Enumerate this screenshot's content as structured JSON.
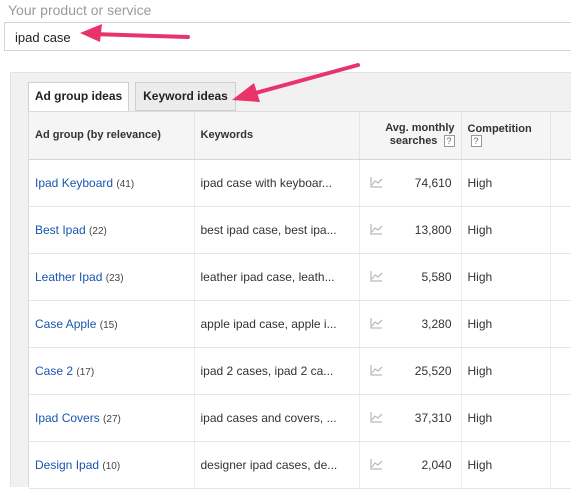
{
  "search": {
    "label": "Your product or service",
    "value": "ipad case"
  },
  "tabs": [
    {
      "label": "Ad group ideas",
      "active": true
    },
    {
      "label": "Keyword ideas",
      "active": false
    }
  ],
  "table": {
    "headers": {
      "group": "Ad group (by relevance)",
      "keywords": "Keywords",
      "searches_line1": "Avg. monthly",
      "searches_line2": "searches",
      "competition": "Competition",
      "help": "?"
    },
    "rows": [
      {
        "group": "Ipad Keyboard",
        "count": "(41)",
        "keywords": "ipad case with keyboar...",
        "searches": "74,610",
        "competition": "High"
      },
      {
        "group": "Best Ipad",
        "count": "(22)",
        "keywords": "best ipad case, best ipa...",
        "searches": "13,800",
        "competition": "High"
      },
      {
        "group": "Leather Ipad",
        "count": "(23)",
        "keywords": "leather ipad case, leath...",
        "searches": "5,580",
        "competition": "High"
      },
      {
        "group": "Case Apple",
        "count": "(15)",
        "keywords": "apple ipad case, apple i...",
        "searches": "3,280",
        "competition": "High"
      },
      {
        "group": "Case 2",
        "count": "(17)",
        "keywords": "ipad 2 cases, ipad 2 ca...",
        "searches": "25,520",
        "competition": "High"
      },
      {
        "group": "Ipad Covers",
        "count": "(27)",
        "keywords": "ipad cases and covers, ...",
        "searches": "37,310",
        "competition": "High"
      },
      {
        "group": "Design Ipad",
        "count": "(10)",
        "keywords": "designer ipad cases, de...",
        "searches": "2,040",
        "competition": "High"
      }
    ]
  },
  "colors": {
    "link": "#1a55b0",
    "annotation_arrow": "#e8336b"
  },
  "icons": {
    "trend": "trend-chart-icon",
    "help": "help-icon"
  }
}
